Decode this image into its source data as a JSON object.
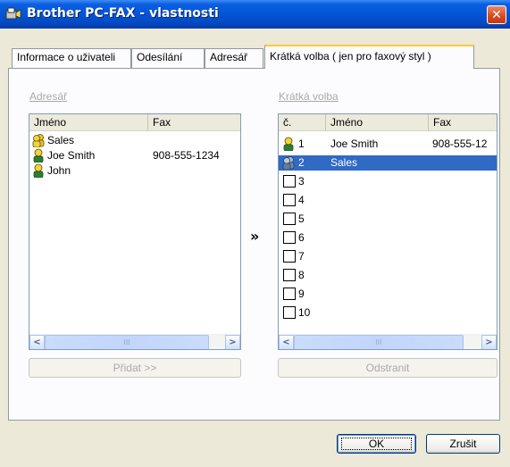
{
  "window": {
    "title": "Brother PC-FAX - vlastnosti",
    "close_label": "✕"
  },
  "tabs": [
    {
      "label": "Informace o uživateli",
      "active": false
    },
    {
      "label": "Odesílání",
      "active": false
    },
    {
      "label": "Adresář",
      "active": false
    },
    {
      "label": "Krátká volba ( jen pro faxový styl )",
      "active": true
    }
  ],
  "address_book": {
    "group_label": "Adresář",
    "columns": [
      "Jméno",
      "Fax"
    ],
    "rows": [
      {
        "name": "Sales",
        "fax": "",
        "icon": "group-icon"
      },
      {
        "name": "Joe Smith",
        "fax": "908-555-1234",
        "icon": "person-icon"
      },
      {
        "name": "John",
        "fax": "",
        "icon": "person-icon"
      }
    ],
    "add_button": "Přidat >>",
    "scroll_thumb": "III"
  },
  "move_arrow": "»",
  "speed_dial": {
    "group_label": "Krátká volba",
    "columns": [
      "č.",
      "Jméno",
      "Fax"
    ],
    "rows": [
      {
        "num": "1",
        "name": "Joe Smith",
        "fax": "908-555-12",
        "icon": "person-icon",
        "selected": false
      },
      {
        "num": "2",
        "name": "Sales",
        "fax": "",
        "icon": "group-icon",
        "selected": true
      },
      {
        "num": "3",
        "name": "",
        "fax": "",
        "icon": "empty",
        "selected": false
      },
      {
        "num": "4",
        "name": "",
        "fax": "",
        "icon": "empty",
        "selected": false
      },
      {
        "num": "5",
        "name": "",
        "fax": "",
        "icon": "empty",
        "selected": false
      },
      {
        "num": "6",
        "name": "",
        "fax": "",
        "icon": "empty",
        "selected": false
      },
      {
        "num": "7",
        "name": "",
        "fax": "",
        "icon": "empty",
        "selected": false
      },
      {
        "num": "8",
        "name": "",
        "fax": "",
        "icon": "empty",
        "selected": false
      },
      {
        "num": "9",
        "name": "",
        "fax": "",
        "icon": "empty",
        "selected": false
      },
      {
        "num": "10",
        "name": "",
        "fax": "",
        "icon": "empty",
        "selected": false
      }
    ],
    "remove_button": "Odstranit",
    "scroll_thumb": "III"
  },
  "footer": {
    "ok_label": "OK",
    "cancel_label": "Zrušit"
  },
  "colors": {
    "titlebar": "#0455d6",
    "selection": "#316ac5",
    "active_tab_accent": "#ffc83c",
    "close_button": "#d9471e"
  }
}
